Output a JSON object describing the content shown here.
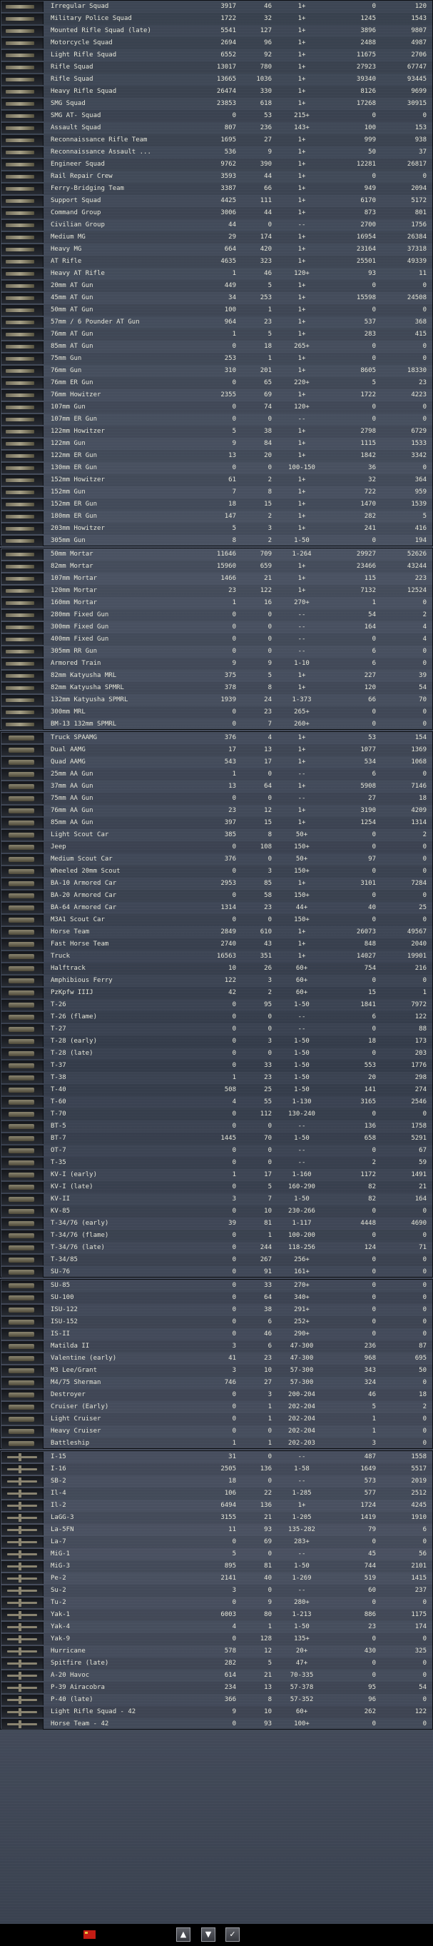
{
  "sections": [
    {
      "rows": [
        [
          "Irregular Squad",
          "3917",
          "46",
          "1+",
          "0",
          "120"
        ],
        [
          "Military Police Squad",
          "1722",
          "32",
          "1+",
          "1245",
          "1543"
        ],
        [
          "Mounted Rifle Squad (late)",
          "5541",
          "127",
          "1+",
          "3896",
          "9807"
        ],
        [
          "Motorcycle Squad",
          "2694",
          "96",
          "1+",
          "2488",
          "4987"
        ],
        [
          "Light Rifle Squad",
          "6552",
          "92",
          "1+",
          "11675",
          "2706"
        ],
        [
          "Rifle Squad",
          "13017",
          "780",
          "1+",
          "27923",
          "67747"
        ],
        [
          "Rifle Squad",
          "13665",
          "1036",
          "1+",
          "39340",
          "93445"
        ],
        [
          "Heavy Rifle Squad",
          "26474",
          "330",
          "1+",
          "8126",
          "9699"
        ],
        [
          "SMG Squad",
          "23853",
          "618",
          "1+",
          "17268",
          "30915"
        ],
        [
          "SMG AT- Squad",
          "0",
          "53",
          "215+",
          "0",
          "0"
        ],
        [
          "Assault Squad",
          "807",
          "236",
          "143+",
          "100",
          "153"
        ],
        [
          "Reconnaissance Rifle Team",
          "1695",
          "27",
          "1+",
          "999",
          "938"
        ],
        [
          "Reconnaissance Assault ...",
          "536",
          "9",
          "1+",
          "50",
          "37"
        ],
        [
          "Engineer Squad",
          "9762",
          "390",
          "1+",
          "12281",
          "26817"
        ],
        [
          "Rail Repair Crew",
          "3593",
          "44",
          "1+",
          "0",
          "0"
        ],
        [
          "Ferry-Bridging Team",
          "3387",
          "66",
          "1+",
          "949",
          "2094"
        ],
        [
          "Support Squad",
          "4425",
          "111",
          "1+",
          "6170",
          "5172"
        ],
        [
          "Command Group",
          "3006",
          "44",
          "1+",
          "873",
          "801"
        ],
        [
          "Civilian Group",
          "44",
          "0",
          "--",
          "2700",
          "1756"
        ],
        [
          "Medium MG",
          "29",
          "174",
          "1+",
          "16954",
          "26384"
        ],
        [
          "Heavy MG",
          "664",
          "420",
          "1+",
          "23164",
          "37318"
        ],
        [
          "AT Rifle",
          "4635",
          "323",
          "1+",
          "25501",
          "49339"
        ],
        [
          "Heavy AT Rifle",
          "1",
          "46",
          "120+",
          "93",
          "11"
        ],
        [
          "20mm AT Gun",
          "449",
          "5",
          "1+",
          "0",
          "0"
        ],
        [
          "45mm AT Gun",
          "34",
          "253",
          "1+",
          "15598",
          "24508"
        ],
        [
          "50mm AT Gun",
          "100",
          "1",
          "1+",
          "0",
          "0"
        ],
        [
          "57mm / 6 Pounder AT Gun",
          "964",
          "23",
          "1+",
          "537",
          "368"
        ],
        [
          "76mm AT Gun",
          "1",
          "5",
          "1+",
          "283",
          "415"
        ],
        [
          "85mm AT Gun",
          "0",
          "18",
          "265+",
          "0",
          "0"
        ],
        [
          "75mm Gun",
          "253",
          "1",
          "1+",
          "0",
          "0"
        ],
        [
          "76mm Gun",
          "310",
          "201",
          "1+",
          "8605",
          "18330"
        ],
        [
          "76mm ER Gun",
          "0",
          "65",
          "220+",
          "5",
          "23"
        ],
        [
          "76mm Howitzer",
          "2355",
          "69",
          "1+",
          "1722",
          "4223"
        ],
        [
          "107mm Gun",
          "0",
          "74",
          "120+",
          "0",
          "0"
        ],
        [
          "107mm ER Gun",
          "0",
          "0",
          "--",
          "0",
          "0"
        ],
        [
          "122mm Howitzer",
          "5",
          "38",
          "1+",
          "2798",
          "6729"
        ],
        [
          "122mm Gun",
          "9",
          "84",
          "1+",
          "1115",
          "1533"
        ],
        [
          "122mm ER Gun",
          "13",
          "20",
          "1+",
          "1842",
          "3342"
        ],
        [
          "130mm ER Gun",
          "0",
          "0",
          "100-150",
          "36",
          "0"
        ],
        [
          "152mm Howitzer",
          "61",
          "2",
          "1+",
          "32",
          "364"
        ],
        [
          "152mm Gun",
          "7",
          "8",
          "1+",
          "722",
          "959"
        ],
        [
          "152mm ER Gun",
          "18",
          "15",
          "1+",
          "1470",
          "1539"
        ],
        [
          "180mm ER Gun",
          "147",
          "2",
          "1+",
          "282",
          "5"
        ],
        [
          "203mm Howitzer",
          "5",
          "3",
          "1+",
          "241",
          "416"
        ],
        [
          "305mm Gun",
          "8",
          "2",
          "1-50",
          "0",
          "194"
        ]
      ]
    },
    {
      "rows": [
        [
          "50mm Mortar",
          "11646",
          "709",
          "1-264",
          "29927",
          "52626"
        ],
        [
          "82mm Mortar",
          "15960",
          "659",
          "1+",
          "23466",
          "43244"
        ],
        [
          "107mm Mortar",
          "1466",
          "21",
          "1+",
          "115",
          "223"
        ],
        [
          "120mm Mortar",
          "23",
          "122",
          "1+",
          "7132",
          "12524"
        ],
        [
          "160mm Mortar",
          "1",
          "16",
          "270+",
          "1",
          "0"
        ],
        [
          "280mm Fixed Gun",
          "0",
          "0",
          "--",
          "54",
          "2"
        ],
        [
          "300mm Fixed Gun",
          "0",
          "0",
          "--",
          "164",
          "4"
        ],
        [
          "400mm Fixed Gun",
          "0",
          "0",
          "--",
          "0",
          "4"
        ],
        [
          "305mm RR Gun",
          "0",
          "0",
          "--",
          "6",
          "0"
        ],
        [
          "Armored Train",
          "9",
          "9",
          "1-10",
          "6",
          "0"
        ],
        [
          "82mm Katyusha MRL",
          "375",
          "5",
          "1+",
          "227",
          "39"
        ],
        [
          "82mm Katyusha SPMRL",
          "378",
          "8",
          "1+",
          "120",
          "54"
        ],
        [
          "132mm Katyusha SPMRL",
          "1939",
          "24",
          "1-373",
          "66",
          "70"
        ],
        [
          "300mm MRL",
          "0",
          "23",
          "265+",
          "0",
          "0"
        ],
        [
          "BM-13 132mm SPMRL",
          "0",
          "7",
          "260+",
          "0",
          "0"
        ]
      ]
    },
    {
      "rows": [
        [
          "Truck SPAAMG",
          "376",
          "4",
          "1+",
          "53",
          "154"
        ],
        [
          "Dual AAMG",
          "17",
          "13",
          "1+",
          "1077",
          "1369"
        ],
        [
          "Quad AAMG",
          "543",
          "17",
          "1+",
          "534",
          "1068"
        ],
        [
          "25mm AA Gun",
          "1",
          "0",
          "--",
          "6",
          "0"
        ],
        [
          "37mm AA Gun",
          "13",
          "64",
          "1+",
          "5908",
          "7146"
        ],
        [
          "75mm AA Gun",
          "0",
          "0",
          "--",
          "27",
          "18"
        ],
        [
          "76mm AA Gun",
          "23",
          "12",
          "1+",
          "3190",
          "4209"
        ],
        [
          "85mm AA Gun",
          "397",
          "15",
          "1+",
          "1254",
          "1314"
        ],
        [
          "Light Scout Car",
          "385",
          "8",
          "50+",
          "0",
          "2"
        ],
        [
          "Jeep",
          "0",
          "108",
          "150+",
          "0",
          "0"
        ],
        [
          "Medium Scout Car",
          "376",
          "0",
          "50+",
          "97",
          "0"
        ],
        [
          "Wheeled 20mm Scout",
          "0",
          "3",
          "150+",
          "0",
          "0"
        ],
        [
          "BA-10 Armored Car",
          "2953",
          "85",
          "1+",
          "3101",
          "7284"
        ],
        [
          "BA-20 Armored Car",
          "0",
          "58",
          "150+",
          "0",
          "0"
        ],
        [
          "BA-64 Armored Car",
          "1314",
          "23",
          "44+",
          "40",
          "25"
        ],
        [
          "M3A1 Scout Car",
          "0",
          "0",
          "150+",
          "0",
          "0"
        ],
        [
          "Horse Team",
          "2849",
          "610",
          "1+",
          "26073",
          "49567"
        ],
        [
          "Fast Horse Team",
          "2740",
          "43",
          "1+",
          "848",
          "2040"
        ],
        [
          "Truck",
          "16563",
          "351",
          "1+",
          "14027",
          "19901"
        ],
        [
          "Halftrack",
          "10",
          "26",
          "60+",
          "754",
          "216"
        ],
        [
          "Amphibious Ferry",
          "122",
          "3",
          "60+",
          "0",
          "0"
        ],
        [
          "PzKpfw IIIJ",
          "42",
          "2",
          "60+",
          "15",
          "1"
        ],
        [
          "T-26",
          "0",
          "95",
          "1-50",
          "1841",
          "7972"
        ],
        [
          "T-26 (flame)",
          "0",
          "0",
          "--",
          "6",
          "122"
        ],
        [
          "T-27",
          "0",
          "0",
          "--",
          "0",
          "88"
        ],
        [
          "T-28 (early)",
          "0",
          "3",
          "1-50",
          "18",
          "173"
        ],
        [
          "T-28 (late)",
          "0",
          "0",
          "1-50",
          "0",
          "203"
        ],
        [
          "T-37",
          "0",
          "33",
          "1-50",
          "553",
          "1776"
        ],
        [
          "T-38",
          "1",
          "23",
          "1-50",
          "20",
          "298"
        ],
        [
          "T-40",
          "508",
          "25",
          "1-50",
          "141",
          "274"
        ],
        [
          "T-60",
          "4",
          "55",
          "1-130",
          "3165",
          "2546"
        ],
        [
          "T-70",
          "0",
          "112",
          "130-240",
          "0",
          "0"
        ],
        [
          "BT-5",
          "0",
          "0",
          "--",
          "136",
          "1758"
        ],
        [
          "BT-7",
          "1445",
          "70",
          "1-50",
          "658",
          "5291"
        ],
        [
          "OT-7",
          "0",
          "0",
          "--",
          "0",
          "67"
        ],
        [
          "T-35",
          "0",
          "0",
          "--",
          "2",
          "59"
        ],
        [
          "KV-I (early)",
          "1",
          "17",
          "1-160",
          "1172",
          "1491"
        ],
        [
          "KV-I (late)",
          "0",
          "5",
          "160-290",
          "82",
          "21"
        ],
        [
          "KV-II",
          "3",
          "7",
          "1-50",
          "82",
          "164"
        ],
        [
          "KV-85",
          "0",
          "10",
          "230-266",
          "0",
          "0"
        ],
        [
          "T-34/76 (early)",
          "39",
          "81",
          "1-117",
          "4448",
          "4690"
        ],
        [
          "T-34/76 (flame)",
          "0",
          "1",
          "100-200",
          "0",
          "0"
        ],
        [
          "T-34/76 (late)",
          "0",
          "244",
          "118-256",
          "124",
          "71"
        ],
        [
          "T-34/85",
          "0",
          "267",
          "256+",
          "0",
          "0"
        ],
        [
          "SU-76",
          "0",
          "91",
          "161+",
          "0",
          "0"
        ]
      ]
    },
    {
      "rows": [
        [
          "SU-85",
          "0",
          "33",
          "270+",
          "0",
          "0"
        ],
        [
          "SU-100",
          "0",
          "64",
          "340+",
          "0",
          "0"
        ],
        [
          "ISU-122",
          "0",
          "38",
          "291+",
          "0",
          "0"
        ],
        [
          "ISU-152",
          "0",
          "6",
          "252+",
          "0",
          "0"
        ],
        [
          "IS-II",
          "0",
          "46",
          "290+",
          "0",
          "0"
        ],
        [
          "Matilda II",
          "3",
          "6",
          "47-300",
          "236",
          "87"
        ],
        [
          "Valentine (early)",
          "41",
          "23",
          "47-300",
          "968",
          "695"
        ],
        [
          "M3 Lee/Grant",
          "3",
          "10",
          "57-300",
          "343",
          "50"
        ],
        [
          "M4/75 Sherman",
          "746",
          "27",
          "57-300",
          "324",
          "0"
        ],
        [
          "Destroyer",
          "0",
          "3",
          "200-204",
          "46",
          "18"
        ],
        [
          "Cruiser (Early)",
          "0",
          "1",
          "202-204",
          "5",
          "2"
        ],
        [
          "Light Cruiser",
          "0",
          "1",
          "202-204",
          "1",
          "0"
        ],
        [
          "Heavy Cruiser",
          "0",
          "0",
          "202-204",
          "1",
          "0"
        ],
        [
          "Battleship",
          "1",
          "1",
          "202-203",
          "3",
          "0"
        ]
      ]
    },
    {
      "rows": [
        [
          "I-15",
          "31",
          "0",
          "--",
          "487",
          "1558"
        ],
        [
          "I-16",
          "2505",
          "136",
          "1-58",
          "1649",
          "5517"
        ],
        [
          "SB-2",
          "18",
          "0",
          "--",
          "573",
          "2019"
        ],
        [
          "Il-4",
          "106",
          "22",
          "1-285",
          "577",
          "2512"
        ],
        [
          "Il-2",
          "6494",
          "136",
          "1+",
          "1724",
          "4245"
        ],
        [
          "LaGG-3",
          "3155",
          "21",
          "1-205",
          "1419",
          "1910"
        ],
        [
          "La-5FN",
          "11",
          "93",
          "135-282",
          "79",
          "6"
        ],
        [
          "La-7",
          "0",
          "69",
          "283+",
          "0",
          "0"
        ],
        [
          "MiG-1",
          "5",
          "0",
          "--",
          "45",
          "56"
        ],
        [
          "MiG-3",
          "895",
          "81",
          "1-50",
          "744",
          "2101"
        ],
        [
          "Pe-2",
          "2141",
          "40",
          "1-269",
          "519",
          "1415"
        ],
        [
          "Su-2",
          "3",
          "0",
          "--",
          "60",
          "237"
        ],
        [
          "Tu-2",
          "0",
          "9",
          "280+",
          "0",
          "0"
        ],
        [
          "Yak-1",
          "6003",
          "80",
          "1-213",
          "886",
          "1175"
        ],
        [
          "Yak-4",
          "4",
          "1",
          "1-50",
          "23",
          "174"
        ],
        [
          "Yak-9",
          "0",
          "128",
          "135+",
          "0",
          "0"
        ],
        [
          "Hurricane",
          "578",
          "12",
          "20+",
          "430",
          "325"
        ],
        [
          "Spitfire (late)",
          "282",
          "5",
          "47+",
          "0",
          "0"
        ],
        [
          "A-20 Havoc",
          "614",
          "21",
          "70-335",
          "0",
          "0"
        ],
        [
          "P-39 Airacobra",
          "234",
          "13",
          "57-378",
          "95",
          "54"
        ],
        [
          "P-40 (late)",
          "366",
          "8",
          "57-352",
          "96",
          "0"
        ],
        [
          "Light Rifle Squad - 42",
          "9",
          "10",
          "60+",
          "262",
          "122"
        ],
        [
          "Horse Team - 42",
          "0",
          "93",
          "100+",
          "0",
          "0"
        ]
      ]
    }
  ],
  "bottombar": {
    "flag_icon": "soviet-flag-icon",
    "buttons": [
      {
        "name": "scroll-up-button",
        "glyph": "▲"
      },
      {
        "name": "scroll-down-button",
        "glyph": "▼"
      },
      {
        "name": "confirm-button",
        "glyph": "✓"
      }
    ]
  }
}
